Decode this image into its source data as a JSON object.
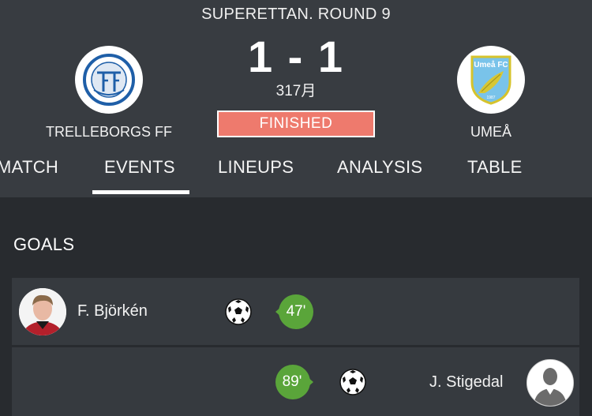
{
  "match": {
    "competition": "SUPERETTAN. ROUND 9",
    "score": "1 - 1",
    "date": "317月",
    "status": "FINISHED",
    "home_team": {
      "name": "TRELLEBORGS FF",
      "logo_icon": "trelleborgs-ff-crest-icon"
    },
    "away_team": {
      "name": "UMEÅ",
      "logo_icon": "umea-fc-crest-icon",
      "logo_text": "Umeå FC",
      "logo_year": "1987"
    }
  },
  "tabs": [
    {
      "label": "MATCH",
      "active": false
    },
    {
      "label": "EVENTS",
      "active": true
    },
    {
      "label": "LINEUPS",
      "active": false
    },
    {
      "label": "ANALYSIS",
      "active": false
    },
    {
      "label": "TABLE",
      "active": false
    }
  ],
  "goals": {
    "title": "GOALS",
    "events": [
      {
        "player": "F. Björkén",
        "minute": "47'",
        "side": "home"
      },
      {
        "player": "J. Stigedal",
        "minute": "89'",
        "side": "away"
      }
    ]
  },
  "colors": {
    "header_bg": "#383c41",
    "page_bg": "#282b2f",
    "row_bg": "#363a3f",
    "finished_badge": "#ee7a6d",
    "minute_badge": "#5aa53a"
  }
}
